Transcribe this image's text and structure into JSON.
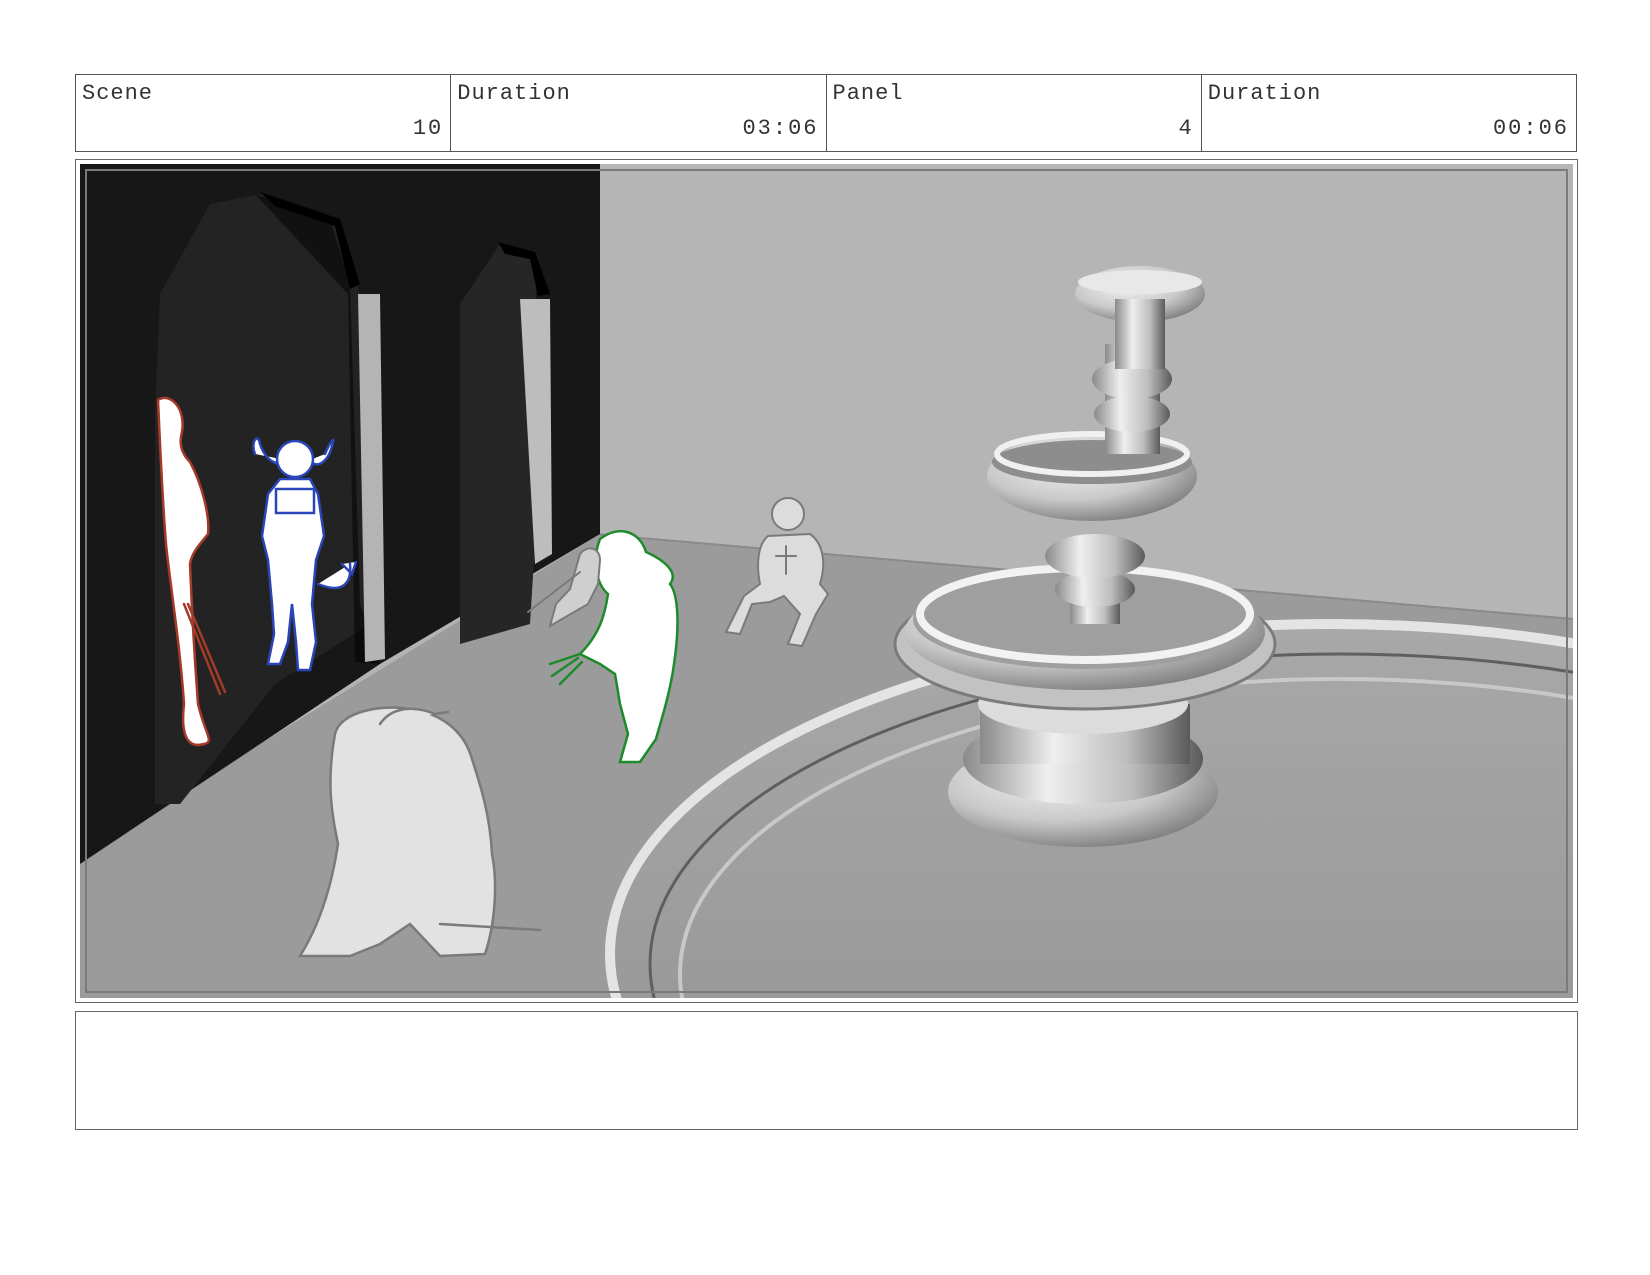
{
  "header": {
    "cells": [
      {
        "label": "Scene",
        "value": "10"
      },
      {
        "label": "Duration",
        "value": "03:06"
      },
      {
        "label": "Panel",
        "value": "4"
      },
      {
        "label": "Duration",
        "value": "00:06"
      }
    ]
  },
  "panel": {
    "subject": [
      "arched-wall",
      "fountain",
      "red-character",
      "blue-horned-character",
      "green-character",
      "sitting-grey-character",
      "crouching-grey-character",
      "kneeling-grey-character"
    ],
    "colors": {
      "wall": "#171717",
      "floor": "#9a9a9a",
      "back_wall": "#b4b4b4",
      "red_sketch": "#a33a2a",
      "blue_sketch": "#2a45b8",
      "green_sketch": "#1d8a2c",
      "grey_sketch": "#7a7a7a"
    }
  },
  "notes": {
    "text": ""
  }
}
